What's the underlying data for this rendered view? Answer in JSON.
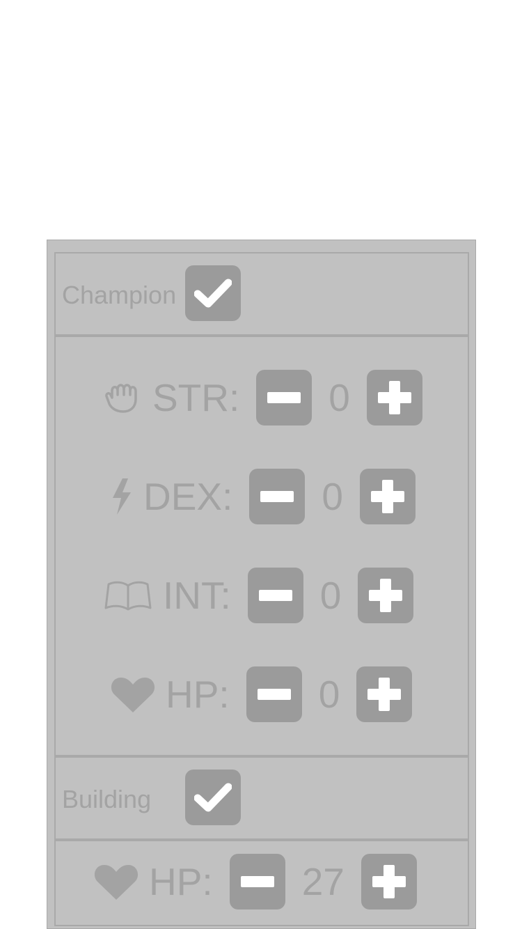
{
  "champion": {
    "label": "Champion",
    "checked": true
  },
  "champion_stats": [
    {
      "key": "str",
      "icon": "hand-icon",
      "label": "STR:",
      "value": "0"
    },
    {
      "key": "dex",
      "icon": "lightning-icon",
      "label": "DEX:",
      "value": "0"
    },
    {
      "key": "int",
      "icon": "book-icon",
      "label": "INT:",
      "value": "0"
    },
    {
      "key": "hp",
      "icon": "heart-icon",
      "label": "HP:",
      "value": "0"
    }
  ],
  "building": {
    "label": "Building",
    "checked": true
  },
  "building_stats": [
    {
      "key": "hp",
      "icon": "heart-icon",
      "label": "HP:",
      "value": "27"
    }
  ],
  "colors": {
    "panel": "#c1c1c1",
    "button": "#9b9b9b",
    "text": "#a3a3a3",
    "border": "#a9a9a9"
  }
}
